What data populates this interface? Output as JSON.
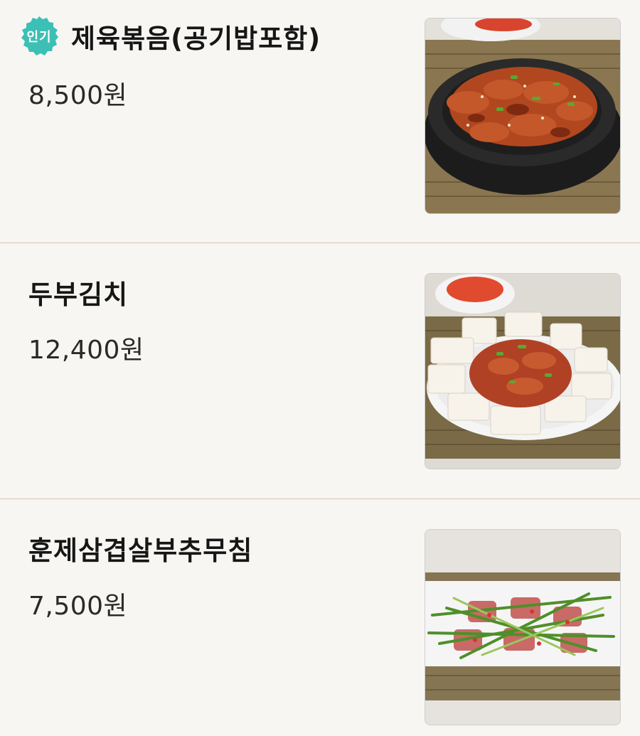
{
  "menu": {
    "items": [
      {
        "badge": "인기",
        "name": "제육볶음(공기밥포함)",
        "price": "8,500원",
        "image_icon": "stir-fried-pork-image"
      },
      {
        "name": "두부김치",
        "price": "12,400원",
        "image_icon": "tofu-kimchi-image"
      },
      {
        "name": "훈제삼겹살부추무침",
        "price": "7,500원",
        "image_icon": "smoked-pork-chive-salad-image"
      }
    ]
  },
  "colors": {
    "background": "#f7f6f2",
    "badge": "#3cbfb5",
    "divider": "#dcc6ae"
  }
}
